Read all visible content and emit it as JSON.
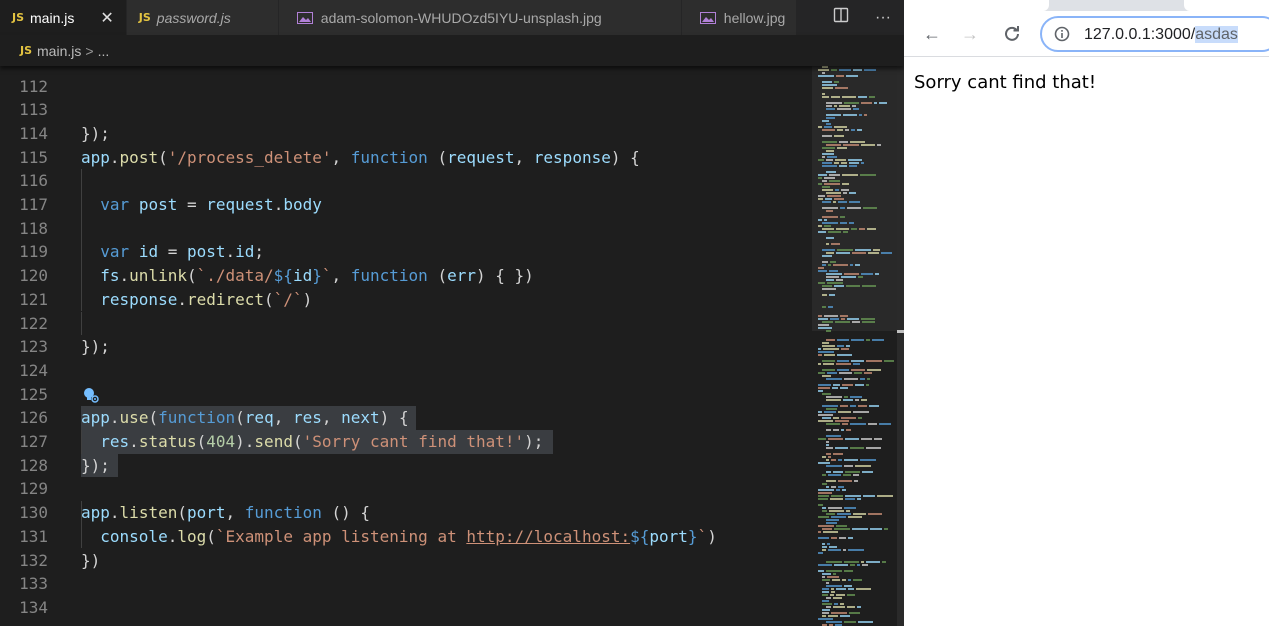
{
  "editor": {
    "tabs": [
      {
        "label": "main.js",
        "type": "js",
        "active": true
      },
      {
        "label": "password.js",
        "type": "js",
        "active": false
      },
      {
        "label": "adam-solomon-WHUDOzd5IYU-unsplash.jpg",
        "type": "image",
        "active": false
      },
      {
        "label": "hellow.jpg",
        "type": "image",
        "active": false
      }
    ],
    "js_badge": "JS",
    "close_glyph": "✕",
    "split_icon": "split-editor-icon",
    "more_glyph": "···",
    "breadcrumb": {
      "file": "main.js",
      "separator": ">",
      "tail": "..."
    },
    "lines": [
      {
        "n": "112",
        "tokens": []
      },
      {
        "n": "113",
        "tokens": []
      },
      {
        "n": "114",
        "tokens": [
          [
            "pun",
            "});"
          ]
        ]
      },
      {
        "n": "115",
        "tokens": [
          [
            "var",
            "app"
          ],
          [
            "pun",
            "."
          ],
          [
            "fn",
            "post"
          ],
          [
            "pun",
            "("
          ],
          [
            "str",
            "'/process_delete'"
          ],
          [
            "pun",
            ", "
          ],
          [
            "kw",
            "function"
          ],
          [
            "pun",
            " ("
          ],
          [
            "var",
            "request"
          ],
          [
            "pun",
            ", "
          ],
          [
            "var",
            "response"
          ],
          [
            "pun",
            ") {"
          ]
        ]
      },
      {
        "n": "116",
        "tokens": []
      },
      {
        "n": "117",
        "tokens": [
          [
            "pun",
            "  "
          ],
          [
            "kw",
            "var"
          ],
          [
            "pun",
            " "
          ],
          [
            "var",
            "post"
          ],
          [
            "pun",
            " = "
          ],
          [
            "var",
            "request"
          ],
          [
            "pun",
            "."
          ],
          [
            "var",
            "body"
          ]
        ]
      },
      {
        "n": "118",
        "tokens": []
      },
      {
        "n": "119",
        "tokens": [
          [
            "pun",
            "  "
          ],
          [
            "kw",
            "var"
          ],
          [
            "pun",
            " "
          ],
          [
            "var",
            "id"
          ],
          [
            "pun",
            " = "
          ],
          [
            "var",
            "post"
          ],
          [
            "pun",
            "."
          ],
          [
            "var",
            "id"
          ],
          [
            "pun",
            ";"
          ]
        ]
      },
      {
        "n": "120",
        "tokens": [
          [
            "pun",
            "  "
          ],
          [
            "var",
            "fs"
          ],
          [
            "pun",
            "."
          ],
          [
            "fn",
            "unlink"
          ],
          [
            "pun",
            "("
          ],
          [
            "str",
            "`./data/"
          ],
          [
            "tpl",
            "${"
          ],
          [
            "var",
            "id"
          ],
          [
            "tpl",
            "}"
          ],
          [
            "str",
            "`"
          ],
          [
            "pun",
            ", "
          ],
          [
            "kw",
            "function"
          ],
          [
            "pun",
            " ("
          ],
          [
            "var",
            "err"
          ],
          [
            "pun",
            ") { })"
          ]
        ]
      },
      {
        "n": "121",
        "tokens": [
          [
            "pun",
            "  "
          ],
          [
            "var",
            "response"
          ],
          [
            "pun",
            "."
          ],
          [
            "fn",
            "redirect"
          ],
          [
            "pun",
            "("
          ],
          [
            "str",
            "`/`"
          ],
          [
            "pun",
            ")"
          ]
        ]
      },
      {
        "n": "122",
        "tokens": []
      },
      {
        "n": "123",
        "tokens": [
          [
            "pun",
            "});"
          ]
        ]
      },
      {
        "n": "124",
        "tokens": []
      },
      {
        "n": "125",
        "tokens": [],
        "bulb": true
      },
      {
        "n": "126",
        "tokens": [
          [
            "var",
            "app"
          ],
          [
            "pun",
            "."
          ],
          [
            "fn",
            "use"
          ],
          [
            "pun",
            "("
          ],
          [
            "kw",
            "function"
          ],
          [
            "pun",
            "("
          ],
          [
            "var",
            "req"
          ],
          [
            "pun",
            ", "
          ],
          [
            "var",
            "res"
          ],
          [
            "pun",
            ", "
          ],
          [
            "var",
            "next"
          ],
          [
            "pun",
            ") {"
          ]
        ],
        "sel": 335
      },
      {
        "n": "127",
        "tokens": [
          [
            "pun",
            "  "
          ],
          [
            "var",
            "res"
          ],
          [
            "pun",
            "."
          ],
          [
            "fn",
            "status"
          ],
          [
            "pun",
            "("
          ],
          [
            "num",
            "404"
          ],
          [
            "pun",
            ")."
          ],
          [
            "fn",
            "send"
          ],
          [
            "pun",
            "("
          ],
          [
            "str",
            "'Sorry cant find that!'"
          ],
          [
            "pun",
            ");"
          ]
        ],
        "sel": 472
      },
      {
        "n": "128",
        "tokens": [
          [
            "pun",
            "});"
          ]
        ],
        "sel": 37
      },
      {
        "n": "129",
        "tokens": []
      },
      {
        "n": "130",
        "tokens": [
          [
            "var",
            "app"
          ],
          [
            "pun",
            "."
          ],
          [
            "fn",
            "listen"
          ],
          [
            "pun",
            "("
          ],
          [
            "var",
            "port"
          ],
          [
            "pun",
            ", "
          ],
          [
            "kw",
            "function"
          ],
          [
            "pun",
            " () {"
          ]
        ]
      },
      {
        "n": "131",
        "tokens": [
          [
            "pun",
            "  "
          ],
          [
            "var",
            "console"
          ],
          [
            "pun",
            "."
          ],
          [
            "fn",
            "log"
          ],
          [
            "pun",
            "("
          ],
          [
            "str",
            "`Example app listening at "
          ],
          [
            "url",
            "http://localhost:"
          ],
          [
            "tpl",
            "${"
          ],
          [
            "var",
            "port"
          ],
          [
            "tpl",
            "}"
          ],
          [
            "str",
            "`"
          ],
          [
            "pun",
            ")"
          ]
        ]
      },
      {
        "n": "132",
        "tokens": [
          [
            "pun",
            "})"
          ]
        ]
      },
      {
        "n": "133",
        "tokens": []
      },
      {
        "n": "134",
        "tokens": []
      }
    ]
  },
  "browser": {
    "back_glyph": "←",
    "forward_glyph": "→",
    "reload_glyph": "C",
    "url_host": "127.0.0.1:3000/",
    "url_path": "asdas",
    "page_text": "Sorry cant find that!"
  },
  "colors": {
    "keyword": "#569cd6",
    "function": "#dcdcaa",
    "variable": "#9cdcfe",
    "string": "#ce9178",
    "number": "#b5cea8",
    "selection": "#3a3d41"
  }
}
